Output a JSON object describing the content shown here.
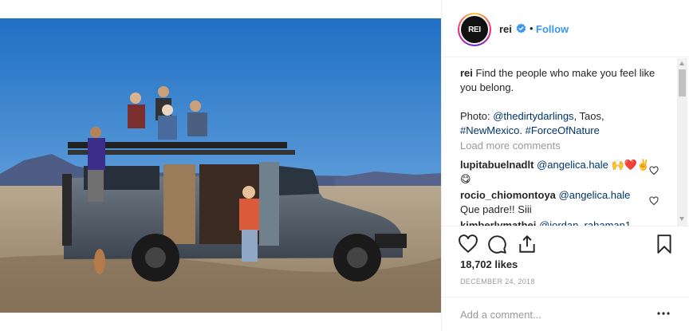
{
  "post": {
    "image_alt": "Group of friends posing on and around a camper van in the New Mexico desert"
  },
  "header": {
    "avatar_text": "REI",
    "username": "rei",
    "separator": "•",
    "follow_label": "Follow"
  },
  "caption": {
    "username": "rei",
    "line1": "Find the people who make you feel like you belong.",
    "photo_prefix": "Photo: ",
    "photo_credit": "@thedirtydarlings",
    "photo_place": ", Taos,",
    "tag1": "#NewMexico",
    "tag_sep": ". ",
    "tag2": "#ForceOfNature"
  },
  "load_more": "Load more comments",
  "comments": [
    {
      "user": "lupitabuelnadlt",
      "mention": "@angelica.hale",
      "text": " 🙌❤️✌️😋"
    },
    {
      "user": "rocio_chiomontoya",
      "mention": "@angelica.hale",
      "text": "Que padre!! Siii"
    },
    {
      "user": "kimberlymathei",
      "mention": "@jordan_rahaman1",
      "text": ""
    }
  ],
  "likes": "18,702 likes",
  "date": "DECEMBER 24, 2018",
  "add_comment": {
    "placeholder": "Add a comment..."
  },
  "icons": {
    "like": "heart-icon",
    "comment": "comment-icon",
    "share": "share-icon",
    "save": "bookmark-icon",
    "more": "more-icon",
    "verified": "verified-badge-icon"
  },
  "colors": {
    "link": "#003569",
    "follow": "#3897f0",
    "muted": "#999999"
  }
}
